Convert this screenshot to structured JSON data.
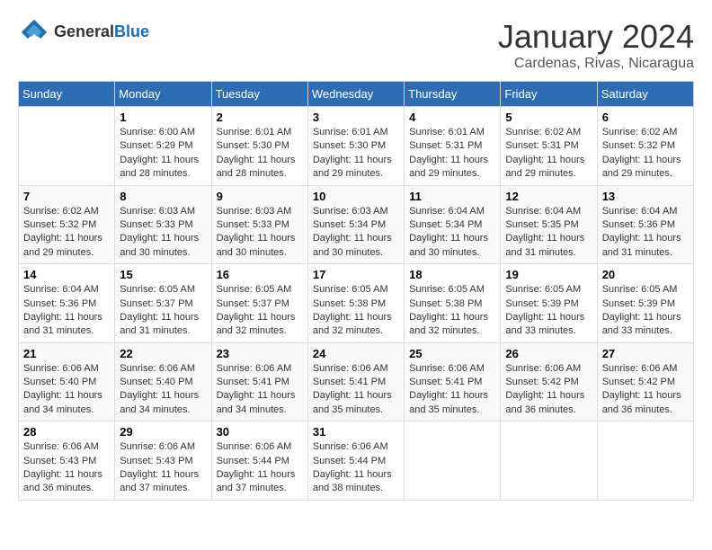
{
  "header": {
    "logo": {
      "general": "General",
      "blue": "Blue"
    },
    "title": "January 2024",
    "location": "Cardenas, Rivas, Nicaragua"
  },
  "columns": [
    "Sunday",
    "Monday",
    "Tuesday",
    "Wednesday",
    "Thursday",
    "Friday",
    "Saturday"
  ],
  "weeks": [
    [
      {
        "day": "",
        "sunrise": "",
        "sunset": "",
        "daylight": ""
      },
      {
        "day": "1",
        "sunrise": "Sunrise: 6:00 AM",
        "sunset": "Sunset: 5:29 PM",
        "daylight": "Daylight: 11 hours and 28 minutes."
      },
      {
        "day": "2",
        "sunrise": "Sunrise: 6:01 AM",
        "sunset": "Sunset: 5:30 PM",
        "daylight": "Daylight: 11 hours and 28 minutes."
      },
      {
        "day": "3",
        "sunrise": "Sunrise: 6:01 AM",
        "sunset": "Sunset: 5:30 PM",
        "daylight": "Daylight: 11 hours and 29 minutes."
      },
      {
        "day": "4",
        "sunrise": "Sunrise: 6:01 AM",
        "sunset": "Sunset: 5:31 PM",
        "daylight": "Daylight: 11 hours and 29 minutes."
      },
      {
        "day": "5",
        "sunrise": "Sunrise: 6:02 AM",
        "sunset": "Sunset: 5:31 PM",
        "daylight": "Daylight: 11 hours and 29 minutes."
      },
      {
        "day": "6",
        "sunrise": "Sunrise: 6:02 AM",
        "sunset": "Sunset: 5:32 PM",
        "daylight": "Daylight: 11 hours and 29 minutes."
      }
    ],
    [
      {
        "day": "7",
        "sunrise": "Sunrise: 6:02 AM",
        "sunset": "Sunset: 5:32 PM",
        "daylight": "Daylight: 11 hours and 29 minutes."
      },
      {
        "day": "8",
        "sunrise": "Sunrise: 6:03 AM",
        "sunset": "Sunset: 5:33 PM",
        "daylight": "Daylight: 11 hours and 30 minutes."
      },
      {
        "day": "9",
        "sunrise": "Sunrise: 6:03 AM",
        "sunset": "Sunset: 5:33 PM",
        "daylight": "Daylight: 11 hours and 30 minutes."
      },
      {
        "day": "10",
        "sunrise": "Sunrise: 6:03 AM",
        "sunset": "Sunset: 5:34 PM",
        "daylight": "Daylight: 11 hours and 30 minutes."
      },
      {
        "day": "11",
        "sunrise": "Sunrise: 6:04 AM",
        "sunset": "Sunset: 5:34 PM",
        "daylight": "Daylight: 11 hours and 30 minutes."
      },
      {
        "day": "12",
        "sunrise": "Sunrise: 6:04 AM",
        "sunset": "Sunset: 5:35 PM",
        "daylight": "Daylight: 11 hours and 31 minutes."
      },
      {
        "day": "13",
        "sunrise": "Sunrise: 6:04 AM",
        "sunset": "Sunset: 5:36 PM",
        "daylight": "Daylight: 11 hours and 31 minutes."
      }
    ],
    [
      {
        "day": "14",
        "sunrise": "Sunrise: 6:04 AM",
        "sunset": "Sunset: 5:36 PM",
        "daylight": "Daylight: 11 hours and 31 minutes."
      },
      {
        "day": "15",
        "sunrise": "Sunrise: 6:05 AM",
        "sunset": "Sunset: 5:37 PM",
        "daylight": "Daylight: 11 hours and 31 minutes."
      },
      {
        "day": "16",
        "sunrise": "Sunrise: 6:05 AM",
        "sunset": "Sunset: 5:37 PM",
        "daylight": "Daylight: 11 hours and 32 minutes."
      },
      {
        "day": "17",
        "sunrise": "Sunrise: 6:05 AM",
        "sunset": "Sunset: 5:38 PM",
        "daylight": "Daylight: 11 hours and 32 minutes."
      },
      {
        "day": "18",
        "sunrise": "Sunrise: 6:05 AM",
        "sunset": "Sunset: 5:38 PM",
        "daylight": "Daylight: 11 hours and 32 minutes."
      },
      {
        "day": "19",
        "sunrise": "Sunrise: 6:05 AM",
        "sunset": "Sunset: 5:39 PM",
        "daylight": "Daylight: 11 hours and 33 minutes."
      },
      {
        "day": "20",
        "sunrise": "Sunrise: 6:05 AM",
        "sunset": "Sunset: 5:39 PM",
        "daylight": "Daylight: 11 hours and 33 minutes."
      }
    ],
    [
      {
        "day": "21",
        "sunrise": "Sunrise: 6:06 AM",
        "sunset": "Sunset: 5:40 PM",
        "daylight": "Daylight: 11 hours and 34 minutes."
      },
      {
        "day": "22",
        "sunrise": "Sunrise: 6:06 AM",
        "sunset": "Sunset: 5:40 PM",
        "daylight": "Daylight: 11 hours and 34 minutes."
      },
      {
        "day": "23",
        "sunrise": "Sunrise: 6:06 AM",
        "sunset": "Sunset: 5:41 PM",
        "daylight": "Daylight: 11 hours and 34 minutes."
      },
      {
        "day": "24",
        "sunrise": "Sunrise: 6:06 AM",
        "sunset": "Sunset: 5:41 PM",
        "daylight": "Daylight: 11 hours and 35 minutes."
      },
      {
        "day": "25",
        "sunrise": "Sunrise: 6:06 AM",
        "sunset": "Sunset: 5:41 PM",
        "daylight": "Daylight: 11 hours and 35 minutes."
      },
      {
        "day": "26",
        "sunrise": "Sunrise: 6:06 AM",
        "sunset": "Sunset: 5:42 PM",
        "daylight": "Daylight: 11 hours and 36 minutes."
      },
      {
        "day": "27",
        "sunrise": "Sunrise: 6:06 AM",
        "sunset": "Sunset: 5:42 PM",
        "daylight": "Daylight: 11 hours and 36 minutes."
      }
    ],
    [
      {
        "day": "28",
        "sunrise": "Sunrise: 6:06 AM",
        "sunset": "Sunset: 5:43 PM",
        "daylight": "Daylight: 11 hours and 36 minutes."
      },
      {
        "day": "29",
        "sunrise": "Sunrise: 6:06 AM",
        "sunset": "Sunset: 5:43 PM",
        "daylight": "Daylight: 11 hours and 37 minutes."
      },
      {
        "day": "30",
        "sunrise": "Sunrise: 6:06 AM",
        "sunset": "Sunset: 5:44 PM",
        "daylight": "Daylight: 11 hours and 37 minutes."
      },
      {
        "day": "31",
        "sunrise": "Sunrise: 6:06 AM",
        "sunset": "Sunset: 5:44 PM",
        "daylight": "Daylight: 11 hours and 38 minutes."
      },
      {
        "day": "",
        "sunrise": "",
        "sunset": "",
        "daylight": ""
      },
      {
        "day": "",
        "sunrise": "",
        "sunset": "",
        "daylight": ""
      },
      {
        "day": "",
        "sunrise": "",
        "sunset": "",
        "daylight": ""
      }
    ]
  ]
}
